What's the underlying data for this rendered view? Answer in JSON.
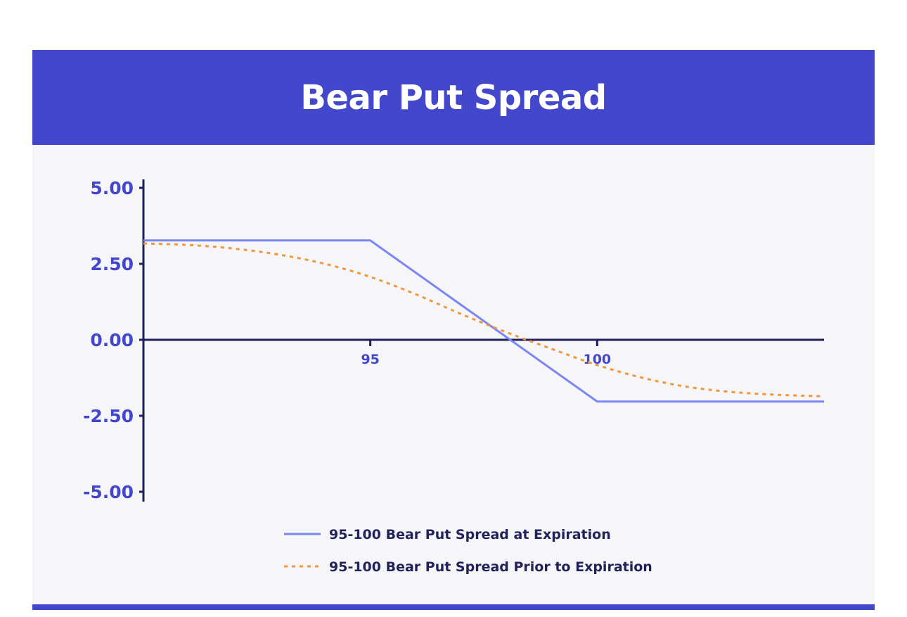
{
  "title": "Bear Put Spread",
  "colors": {
    "header": "#4347cc",
    "axis": "#1e1e5a",
    "series_expiration": "#7b86f5",
    "series_prior": "#f0963c",
    "tick_label": "#4347cc",
    "legend_text": "#22225a"
  },
  "chart_data": {
    "type": "line",
    "title": "Bear Put Spread",
    "xlabel": "",
    "ylabel": "",
    "xlim": [
      90,
      105
    ],
    "ylim": [
      -5,
      5
    ],
    "y_ticks": [
      5.0,
      2.5,
      0.0,
      -2.5,
      -5.0
    ],
    "y_tick_labels": [
      "5.00",
      "2.50",
      "0.00",
      "-2.50",
      "-5.00"
    ],
    "x_ticks": [
      95,
      100
    ],
    "x_tick_labels": [
      "95",
      "100"
    ],
    "grid": false,
    "legend_position": "bottom-center",
    "series": [
      {
        "name": "95-100 Bear Put Spread at Expiration",
        "style": "solid",
        "x": [
          90,
          95,
          100,
          105
        ],
        "y": [
          3.27,
          3.27,
          -2.03,
          -2.03
        ]
      },
      {
        "name": "95-100 Bear Put Spread Prior to Expiration",
        "style": "dashed",
        "x": [
          90,
          91,
          92,
          93,
          94,
          95,
          96,
          97,
          98,
          99,
          100,
          101,
          102,
          103,
          104,
          105
        ],
        "y": [
          3.17,
          3.12,
          3.0,
          2.8,
          2.5,
          2.07,
          1.5,
          0.85,
          0.25,
          -0.3,
          -0.83,
          -1.25,
          -1.55,
          -1.72,
          -1.81,
          -1.86
        ]
      }
    ]
  }
}
